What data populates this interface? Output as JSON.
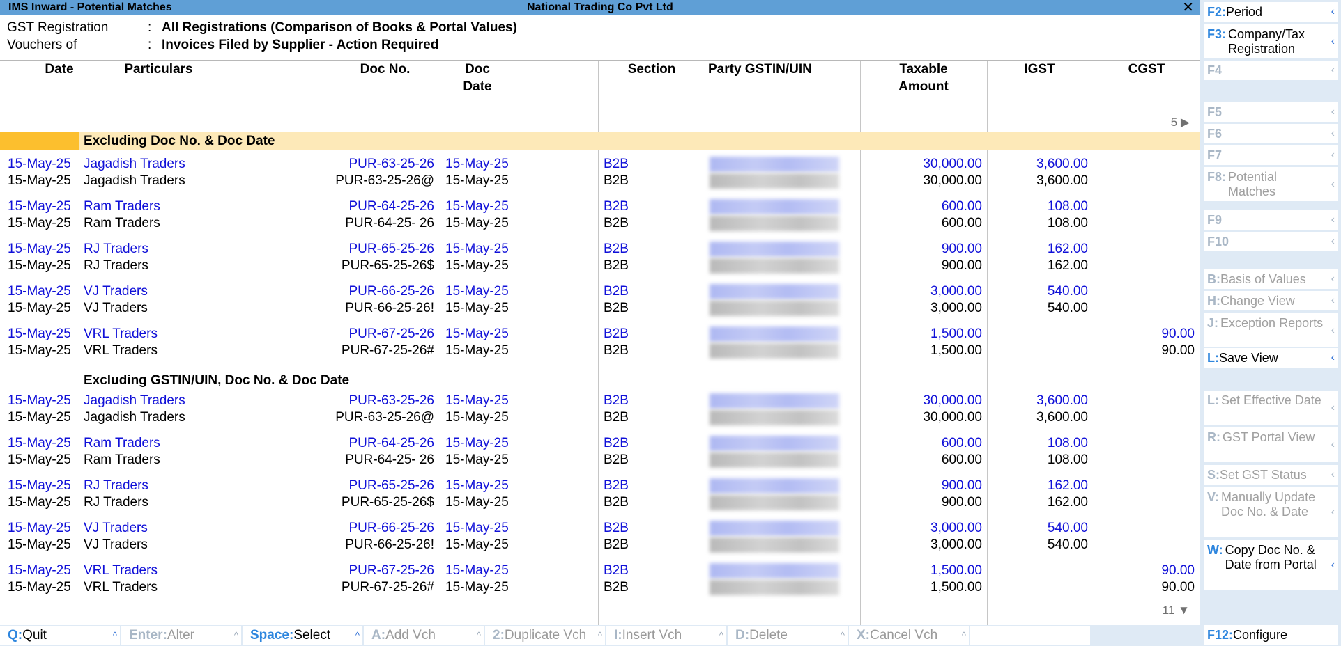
{
  "window": {
    "title": "IMS Inward - Potential Matches",
    "company": "National Trading Co Pvt Ltd",
    "close_symbol": "✕"
  },
  "info": {
    "gst_registration_label": "GST Registration",
    "gst_registration_value": "All Registrations (Comparison of Books & Portal Values)",
    "vouchers_label": "Vouchers of",
    "vouchers_value": "Invoices Filed by Supplier - Action Required",
    "colon": ":"
  },
  "columns": {
    "date": "Date",
    "particulars": "Particulars",
    "doc_no": "Doc No.",
    "doc_date": "Doc\nDate",
    "section": "Section",
    "party_gstin": "Party GSTIN/UIN",
    "taxable": "Taxable\nAmount",
    "igst": "IGST",
    "cgst": "CGST"
  },
  "nav": {
    "top_indicator": "5 ▶",
    "bottom_indicator": "11 ▼"
  },
  "sections": [
    {
      "title": "Excluding Doc No. & Doc Date",
      "pairs": [
        {
          "portal": {
            "date": "15-May-25",
            "party": "Jagadish Traders",
            "doc_no": "PUR-63-25-26",
            "doc_date": "15-May-25",
            "section": "B2B",
            "taxable": "30,000.00",
            "igst": "3,600.00",
            "cgst": ""
          },
          "books": {
            "date": "15-May-25",
            "party": "Jagadish Traders",
            "doc_no": "PUR-63-25-26@",
            "doc_date": "15-May-25",
            "section": "B2B",
            "taxable": "30,000.00",
            "igst": "3,600.00",
            "cgst": ""
          }
        },
        {
          "portal": {
            "date": "15-May-25",
            "party": "Ram Traders",
            "doc_no": "PUR-64-25-26",
            "doc_date": "15-May-25",
            "section": "B2B",
            "taxable": "600.00",
            "igst": "108.00",
            "cgst": ""
          },
          "books": {
            "date": "15-May-25",
            "party": "Ram Traders",
            "doc_no": "PUR-64-25- 26",
            "doc_date": "15-May-25",
            "section": "B2B",
            "taxable": "600.00",
            "igst": "108.00",
            "cgst": ""
          }
        },
        {
          "portal": {
            "date": "15-May-25",
            "party": "RJ Traders",
            "doc_no": "PUR-65-25-26",
            "doc_date": "15-May-25",
            "section": "B2B",
            "taxable": "900.00",
            "igst": "162.00",
            "cgst": ""
          },
          "books": {
            "date": "15-May-25",
            "party": "RJ Traders",
            "doc_no": "PUR-65-25-26$",
            "doc_date": "15-May-25",
            "section": "B2B",
            "taxable": "900.00",
            "igst": "162.00",
            "cgst": ""
          }
        },
        {
          "portal": {
            "date": "15-May-25",
            "party": "VJ Traders",
            "doc_no": "PUR-66-25-26",
            "doc_date": "15-May-25",
            "section": "B2B",
            "taxable": "3,000.00",
            "igst": "540.00",
            "cgst": ""
          },
          "books": {
            "date": "15-May-25",
            "party": "VJ Traders",
            "doc_no": "PUR-66-25-26!",
            "doc_date": "15-May-25",
            "section": "B2B",
            "taxable": "3,000.00",
            "igst": "540.00",
            "cgst": ""
          }
        },
        {
          "portal": {
            "date": "15-May-25",
            "party": "VRL Traders",
            "doc_no": "PUR-67-25-26",
            "doc_date": "15-May-25",
            "section": "B2B",
            "taxable": "1,500.00",
            "igst": "",
            "cgst": "90.00"
          },
          "books": {
            "date": "15-May-25",
            "party": "VRL Traders",
            "doc_no": "PUR-67-25-26#",
            "doc_date": "15-May-25",
            "section": "B2B",
            "taxable": "1,500.00",
            "igst": "",
            "cgst": "90.00"
          }
        }
      ]
    },
    {
      "title": "Excluding GSTIN/UIN, Doc No. & Doc Date",
      "pairs": [
        {
          "portal": {
            "date": "15-May-25",
            "party": "Jagadish Traders",
            "doc_no": "PUR-63-25-26",
            "doc_date": "15-May-25",
            "section": "B2B",
            "taxable": "30,000.00",
            "igst": "3,600.00",
            "cgst": ""
          },
          "books": {
            "date": "15-May-25",
            "party": "Jagadish Traders",
            "doc_no": "PUR-63-25-26@",
            "doc_date": "15-May-25",
            "section": "B2B",
            "taxable": "30,000.00",
            "igst": "3,600.00",
            "cgst": ""
          }
        },
        {
          "portal": {
            "date": "15-May-25",
            "party": "Ram Traders",
            "doc_no": "PUR-64-25-26",
            "doc_date": "15-May-25",
            "section": "B2B",
            "taxable": "600.00",
            "igst": "108.00",
            "cgst": ""
          },
          "books": {
            "date": "15-May-25",
            "party": "Ram Traders",
            "doc_no": "PUR-64-25- 26",
            "doc_date": "15-May-25",
            "section": "B2B",
            "taxable": "600.00",
            "igst": "108.00",
            "cgst": ""
          }
        },
        {
          "portal": {
            "date": "15-May-25",
            "party": "RJ Traders",
            "doc_no": "PUR-65-25-26",
            "doc_date": "15-May-25",
            "section": "B2B",
            "taxable": "900.00",
            "igst": "162.00",
            "cgst": ""
          },
          "books": {
            "date": "15-May-25",
            "party": "RJ Traders",
            "doc_no": "PUR-65-25-26$",
            "doc_date": "15-May-25",
            "section": "B2B",
            "taxable": "900.00",
            "igst": "162.00",
            "cgst": ""
          }
        },
        {
          "portal": {
            "date": "15-May-25",
            "party": "VJ Traders",
            "doc_no": "PUR-66-25-26",
            "doc_date": "15-May-25",
            "section": "B2B",
            "taxable": "3,000.00",
            "igst": "540.00",
            "cgst": ""
          },
          "books": {
            "date": "15-May-25",
            "party": "VJ Traders",
            "doc_no": "PUR-66-25-26!",
            "doc_date": "15-May-25",
            "section": "B2B",
            "taxable": "3,000.00",
            "igst": "540.00",
            "cgst": ""
          }
        },
        {
          "portal": {
            "date": "15-May-25",
            "party": "VRL Traders",
            "doc_no": "PUR-67-25-26",
            "doc_date": "15-May-25",
            "section": "B2B",
            "taxable": "1,500.00",
            "igst": "",
            "cgst": "90.00"
          },
          "books": {
            "date": "15-May-25",
            "party": "VRL Traders",
            "doc_no": "PUR-67-25-26#",
            "doc_date": "15-May-25",
            "section": "B2B",
            "taxable": "1,500.00",
            "igst": "",
            "cgst": "90.00"
          }
        }
      ]
    }
  ],
  "bottom_bar": [
    {
      "key": "Q:",
      "label": "Quit",
      "enabled": true
    },
    {
      "key": "Enter:",
      "label": "Alter",
      "enabled": false
    },
    {
      "key": "Space:",
      "label": "Select",
      "enabled": true
    },
    {
      "key": "A:",
      "label": "Add Vch",
      "enabled": false
    },
    {
      "key": "2:",
      "label": "Duplicate Vch",
      "enabled": false
    },
    {
      "key": "I:",
      "label": "Insert Vch",
      "enabled": false
    },
    {
      "key": "D:",
      "label": "Delete",
      "enabled": false
    },
    {
      "key": "X:",
      "label": "Cancel Vch",
      "enabled": false
    },
    {
      "key": "",
      "label": "",
      "enabled": false
    }
  ],
  "sidebar": {
    "buttons": [
      {
        "key": "F2:",
        "label": "Period",
        "enabled": true
      },
      {
        "key": "F3:",
        "label": "Company/Tax Registration",
        "enabled": true
      },
      {
        "key": "F4",
        "label": "",
        "enabled": false
      },
      {
        "key": "F5",
        "label": "",
        "enabled": false
      },
      {
        "key": "F6",
        "label": "",
        "enabled": false
      },
      {
        "key": "F7",
        "label": "",
        "enabled": false
      },
      {
        "key": "F8:",
        "label": "Potential Matches",
        "enabled": false
      },
      {
        "key": "F9",
        "label": "",
        "enabled": false
      },
      {
        "key": "F10",
        "label": "",
        "enabled": false
      },
      {
        "key": "B:",
        "label": "Basis of Values",
        "enabled": false
      },
      {
        "key": "H:",
        "label": "Change View",
        "enabled": false
      },
      {
        "key": "J:",
        "label": "Exception Reports",
        "enabled": false
      },
      {
        "key": "L:",
        "label": "Save View",
        "enabled": true
      },
      {
        "key": "L:",
        "label": "Set Effective Date",
        "enabled": false
      },
      {
        "key": "R:",
        "label": "GST Portal View",
        "enabled": false
      },
      {
        "key": "S:",
        "label": "Set GST Status",
        "enabled": false
      },
      {
        "key": "V:",
        "label": "Manually Update Doc No. & Date",
        "enabled": false
      },
      {
        "key": "W:",
        "label": "Copy Doc No. & Date from Portal",
        "enabled": true
      },
      {
        "key": "F12:",
        "label": "Configure",
        "enabled": true
      }
    ]
  },
  "colors": {
    "titlebar": "#5f9fd6",
    "portal_text": "#1010d8",
    "section_band": "#fde9b8",
    "section_marker": "#fcbf2e",
    "sidebar_bg": "#dfeaf5",
    "key_color": "#2e86de"
  }
}
